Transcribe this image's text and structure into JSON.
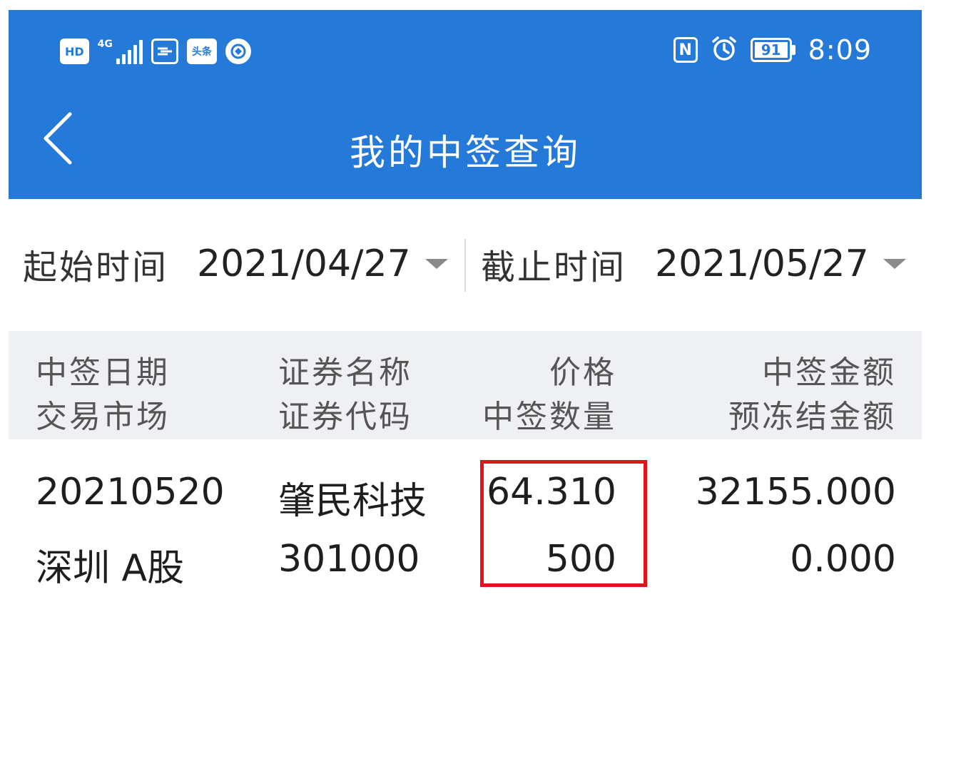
{
  "status_bar": {
    "hd": "HD",
    "network": "4G",
    "app_badge": "头条",
    "nfc": "N",
    "battery": "91",
    "time": "8:09"
  },
  "header": {
    "title": "我的中签查询",
    "back_icon": "chevron-left-icon"
  },
  "filter": {
    "start_label": "起始时间",
    "start_value": "2021/04/27",
    "end_label": "截止时间",
    "end_value": "2021/05/27"
  },
  "table": {
    "columns": [
      {
        "top": "中签日期",
        "bottom": "交易市场"
      },
      {
        "top": "证券名称",
        "bottom": "证券代码"
      },
      {
        "top": "价格",
        "bottom": "中签数量"
      },
      {
        "top": "中签金额",
        "bottom": "预冻结金额"
      }
    ],
    "rows": [
      {
        "date": "20210520",
        "market": "深圳 A股",
        "name": "肇民科技",
        "code": "301000",
        "price": "64.310",
        "quantity": "500",
        "amount": "32155.000",
        "frozen": "0.000"
      }
    ]
  },
  "colors": {
    "header_bg": "#2579d8",
    "table_header_bg": "#eef0f3",
    "highlight": "#e0141c"
  }
}
